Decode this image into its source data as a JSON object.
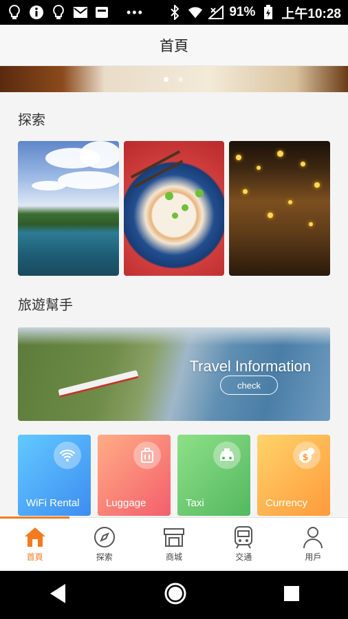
{
  "status": {
    "battery_text": "91%",
    "time": "上午10:28",
    "overflow": "•••",
    "icons": [
      "bulb-icon",
      "info-icon",
      "bulb-icon",
      "mail-icon",
      "app-icon",
      "bluetooth-icon",
      "wifi-icon",
      "signal-icon",
      "battery-icon"
    ]
  },
  "header": {
    "title": "首頁"
  },
  "banner": {
    "active_dot": 0,
    "dot_count": 2
  },
  "explore": {
    "title": "探索",
    "tiles": [
      "coast-photo",
      "food-photo",
      "night-market-photo"
    ]
  },
  "helper": {
    "title": "旅遊幫手",
    "hero_title": "Travel Information",
    "hero_button": "check"
  },
  "services": [
    {
      "label": "WiFi Rental",
      "icon": "wifi-icon",
      "gradient": [
        "#62c9ff",
        "#3d8df0"
      ]
    },
    {
      "label": "Luggage",
      "icon": "luggage-icon",
      "gradient": [
        "#ffad85",
        "#f45e6c"
      ]
    },
    {
      "label": "Taxi",
      "icon": "taxi-icon",
      "gradient": [
        "#8ee088",
        "#53b85f"
      ]
    },
    {
      "label": "Currency",
      "icon": "currency-icon",
      "gradient": [
        "#ffd36a",
        "#ff9a3a"
      ]
    }
  ],
  "tabs": [
    {
      "label": "首頁",
      "icon": "home-icon",
      "active": true
    },
    {
      "label": "探索",
      "icon": "compass-icon",
      "active": false
    },
    {
      "label": "商城",
      "icon": "store-icon",
      "active": false
    },
    {
      "label": "交通",
      "icon": "train-icon",
      "active": false
    },
    {
      "label": "用戶",
      "icon": "user-icon",
      "active": false
    }
  ],
  "colors": {
    "accent": "#f47a20",
    "inactive": "#555555"
  }
}
